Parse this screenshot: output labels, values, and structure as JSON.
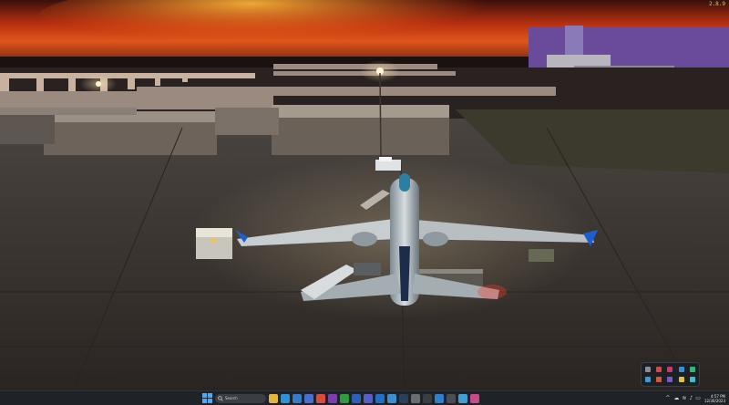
{
  "window": {
    "fps_overlay": "2.8.9"
  },
  "taskbar": {
    "search": {
      "placeholder": "Search"
    },
    "apps": [
      {
        "name": "file-explorer-icon",
        "color": "#e6b43c"
      },
      {
        "name": "edge-icon",
        "color": "#2f8fd9"
      },
      {
        "name": "mail-icon",
        "color": "#3a78c8"
      },
      {
        "name": "store-icon",
        "color": "#4a6fd0"
      },
      {
        "name": "chrome-icon",
        "color": "#d94b3a"
      },
      {
        "name": "onenote-icon",
        "color": "#7a3fb0"
      },
      {
        "name": "xbox-icon",
        "color": "#2e9b3e"
      },
      {
        "name": "word-icon",
        "color": "#2b5fb8"
      },
      {
        "name": "teams-icon",
        "color": "#5a5fc8"
      },
      {
        "name": "outlook-icon",
        "color": "#1f6fc6"
      },
      {
        "name": "photos-icon",
        "color": "#3a8fd0"
      },
      {
        "name": "steam-icon",
        "color": "#2a3f5a"
      },
      {
        "name": "settings-icon",
        "color": "#6a6e74"
      },
      {
        "name": "terminal-icon",
        "color": "#3a3d42"
      },
      {
        "name": "flight-sim-icon",
        "color": "#2f7fd0"
      },
      {
        "name": "calculator-icon",
        "color": "#4a4d52"
      },
      {
        "name": "notepad-icon",
        "color": "#3fa0d8"
      },
      {
        "name": "snip-icon",
        "color": "#c84a8a"
      }
    ],
    "tray": {
      "chevron": "^",
      "clock_time": "4:57 PM",
      "clock_date": "12/30/2023"
    }
  },
  "tray_flyout": {
    "icons": [
      {
        "name": "tray-app-1-icon",
        "color": "#8a8e94"
      },
      {
        "name": "tray-app-2-icon",
        "color": "#d04a4a"
      },
      {
        "name": "tray-app-3-icon",
        "color": "#c83a6a"
      },
      {
        "name": "tray-app-4-icon",
        "color": "#3a8fd0"
      },
      {
        "name": "tray-app-5-icon",
        "color": "#2fb87a"
      },
      {
        "name": "tray-app-6-icon",
        "color": "#3a9bd8"
      },
      {
        "name": "tray-app-7-icon",
        "color": "#d05a3a"
      },
      {
        "name": "tray-app-8-icon",
        "color": "#7a5ac8"
      },
      {
        "name": "tray-app-9-icon",
        "color": "#e0c040"
      },
      {
        "name": "tray-app-10-icon",
        "color": "#3ac0c8"
      }
    ]
  }
}
